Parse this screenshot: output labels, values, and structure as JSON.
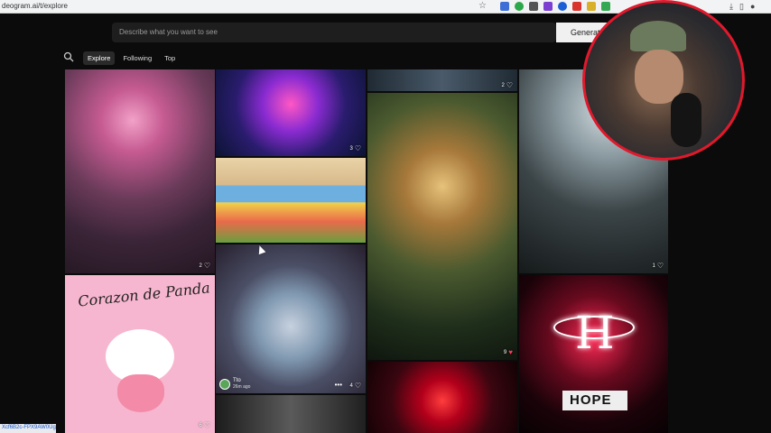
{
  "browser": {
    "url": "deogram.ai/t/explore",
    "status_url": "Xcf6B2c-FPX9AW0Ug/2"
  },
  "prompt": {
    "placeholder": "Describe what you want to see",
    "generate_label": "Generat"
  },
  "tabs": [
    {
      "label": "Explore",
      "active": true
    },
    {
      "label": "Following",
      "active": false
    },
    {
      "label": "Top",
      "active": false
    }
  ],
  "tiles": {
    "mouse": {
      "likes": "3"
    },
    "girl": {
      "likes": "2"
    },
    "top": {
      "likes": "2"
    },
    "lion": {
      "likes": "9"
    },
    "dark": {
      "likes": "1"
    },
    "city": {
      "likes": "4",
      "author": "Tto",
      "time": "26m ago"
    },
    "panda": {
      "title": "Corazon de Panda",
      "likes": "6"
    },
    "hope": {
      "sign": "HOPE"
    }
  },
  "colors": {
    "accent_webcam": "#e0192c",
    "liked_heart": "#ff3b5c"
  }
}
